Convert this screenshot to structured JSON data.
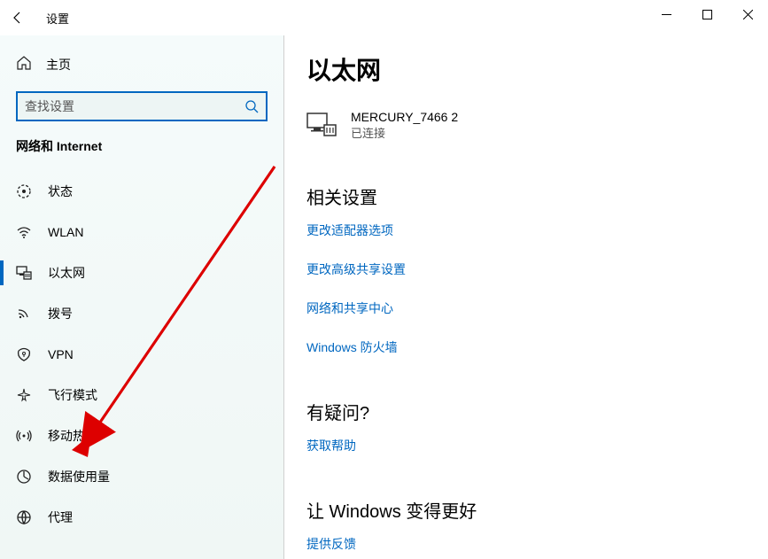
{
  "titlebar": {
    "title": "设置"
  },
  "sidebar": {
    "home_label": "主页",
    "search_placeholder": "查找设置",
    "category": "网络和 Internet",
    "items": [
      {
        "label": "状态",
        "icon": "status"
      },
      {
        "label": "WLAN",
        "icon": "wifi"
      },
      {
        "label": "以太网",
        "icon": "ethernet",
        "active": true
      },
      {
        "label": "拨号",
        "icon": "dialup"
      },
      {
        "label": "VPN",
        "icon": "vpn"
      },
      {
        "label": "飞行模式",
        "icon": "airplane"
      },
      {
        "label": "移动热点",
        "icon": "hotspot"
      },
      {
        "label": "数据使用量",
        "icon": "data"
      },
      {
        "label": "代理",
        "icon": "proxy"
      }
    ]
  },
  "content": {
    "title": "以太网",
    "network": {
      "name": "MERCURY_7466 2",
      "status": "已连接"
    },
    "related_title": "相关设置",
    "related_links": [
      "更改适配器选项",
      "更改高级共享设置",
      "网络和共享中心",
      "Windows 防火墙"
    ],
    "help_title": "有疑问?",
    "help_link": "获取帮助",
    "feedback_title": "让 Windows 变得更好",
    "feedback_link": "提供反馈"
  }
}
